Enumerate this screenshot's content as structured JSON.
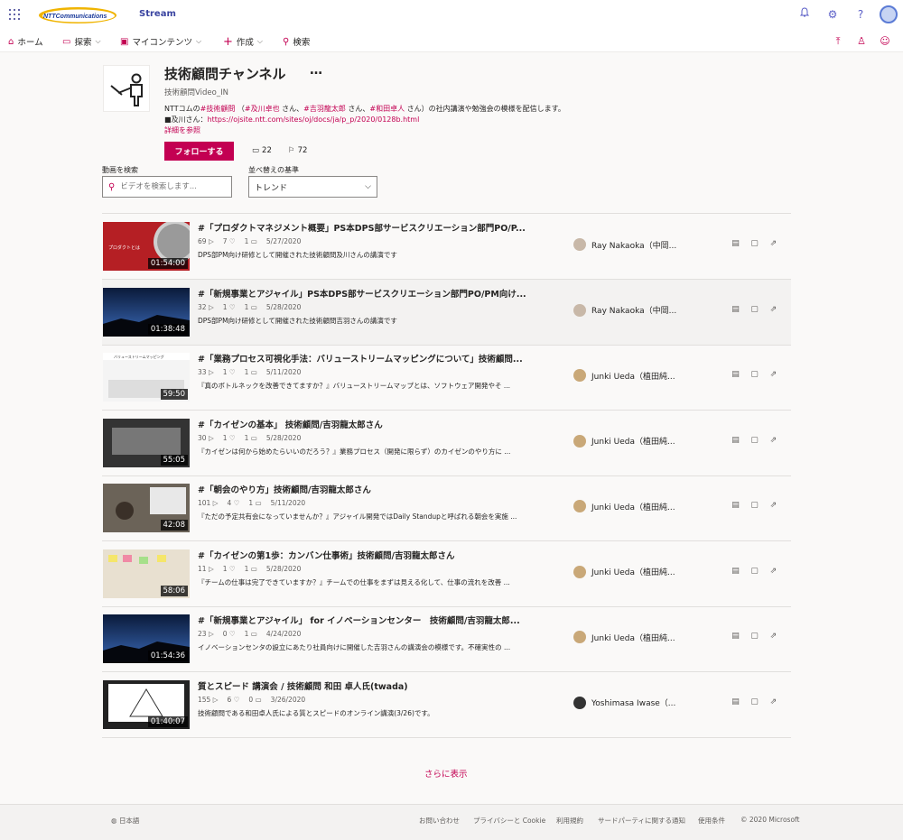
{
  "header": {
    "logo_text": "NTT Communications",
    "app_name": "Stream"
  },
  "nav": {
    "items": [
      {
        "label": "ホーム"
      },
      {
        "label": "探索"
      },
      {
        "label": "マイコンテンツ"
      },
      {
        "label": "作成"
      },
      {
        "label": "検索"
      }
    ]
  },
  "channel": {
    "title": "技術顧問チャンネル",
    "more": "…",
    "subtitle": "技術顧問Video_IN",
    "desc_prefix": "NTTコムの",
    "tag1": "#技術顧問",
    "desc_mid1": "（",
    "tag2": "#及川卓也",
    "desc_mid2": "さん、",
    "tag3": "#吉羽龍太郎",
    "desc_mid3": "さん、",
    "tag4": "#和田卓人",
    "desc_suffix": "さん）の社内講演や勉強会の模様を配信します。",
    "link_prefix": "■及川さん：",
    "link_url": "https://ojsite.ntt.com/sites/oj/docs/ja/p_p/2020/0128b.html",
    "details": "詳細を参照",
    "follow": "フォローする",
    "video_count": "22",
    "follower_count": "72"
  },
  "filters": {
    "search_label": "動画を検索",
    "search_placeholder": "ビデオを検索します...",
    "sort_label": "並べ替えの基準",
    "sort_value": "トレンド"
  },
  "videos": [
    {
      "title": "#「プロダクトマネジメント概要」PS本DPS部サービスクリエーション部門PO/P...",
      "views": "69",
      "likes": "7",
      "comments": "1",
      "date": "5/27/2020",
      "desc": "DPS部PM向け研修として開催された技術顧問及川さんの講演です",
      "author": "Ray Nakaoka（中岡...",
      "duration": "01:54:00"
    },
    {
      "title": "#「新規事業とアジャイル」PS本DPS部サービスクリエーション部門PO/PM向け...",
      "views": "32",
      "likes": "1",
      "comments": "1",
      "date": "5/28/2020",
      "desc": "DPS部PM向け研修として開催された技術顧問吉羽さんの講演です",
      "author": "Ray Nakaoka（中岡...",
      "duration": "01:38:48"
    },
    {
      "title": "#「業務プロセス可視化手法：バリューストリームマッピングについて」技術顧問...",
      "views": "33",
      "likes": "1",
      "comments": "1",
      "date": "5/11/2020",
      "desc": "『真のボトルネックを改善できてますか？』バリューストリームマップとは、ソフトウェア開発やそ ...",
      "author": "Junki Ueda（植田純...",
      "duration": "59:50"
    },
    {
      "title": "#「カイゼンの基本」 技術顧問/吉羽龍太郎さん",
      "views": "30",
      "likes": "1",
      "comments": "1",
      "date": "5/28/2020",
      "desc": "『カイゼンは何から始めたらいいのだろう？』業務プロセス（開発に限らず）のカイゼンのやり方に ...",
      "author": "Junki Ueda（植田純...",
      "duration": "55:05"
    },
    {
      "title": "#「朝会のやり方」技術顧問/吉羽龍太郎さん",
      "views": "101",
      "likes": "4",
      "comments": "1",
      "date": "5/11/2020",
      "desc": "『ただの予定共有会になっていませんか？』アジャイル開発ではDaily Standupと呼ばれる朝会を実施 ...",
      "author": "Junki Ueda（植田純...",
      "duration": "42:08"
    },
    {
      "title": "#「カイゼンの第1歩：カンバン仕事術」技術顧問/吉羽龍太郎さん",
      "views": "11",
      "likes": "1",
      "comments": "1",
      "date": "5/28/2020",
      "desc": "『チームの仕事は完了できていますか？』チームでの仕事をまずは見える化して、仕事の流れを改善 ...",
      "author": "Junki Ueda（植田純...",
      "duration": "58:06"
    },
    {
      "title": "#「新規事業とアジャイル」 for イノベーションセンター　技術顧問/吉羽龍太郎...",
      "views": "23",
      "likes": "0",
      "comments": "1",
      "date": "4/24/2020",
      "desc": "イノベーションセンタの設立にあたり社員向けに開催した吉羽さんの講演会の模様です。不確実性の ...",
      "author": "Junki Ueda（植田純...",
      "duration": "01:54:36"
    },
    {
      "title": "質とスピード 講演会 / 技術顧問 和田 卓人氏(twada)",
      "views": "155",
      "likes": "6",
      "comments": "0",
      "date": "3/26/2020",
      "desc": "技術顧問である和田卓人氏による質とスピードのオンライン講演(3/26)です。",
      "author": "Yoshimasa Iwase（...",
      "duration": "01:40:07"
    }
  ],
  "thumb_text": {
    "v1": "プロダクトとは",
    "v3": "バリューストリームマッピング"
  },
  "more": "さらに表示",
  "footer": {
    "language": "日本語",
    "contact": "お問い合わせ",
    "privacy": "プライバシーと Cookie",
    "terms": "利用規約",
    "third_party": "サードパーティに関する通知",
    "conditions": "使用条件",
    "copyright": "© 2020 Microsoft"
  },
  "colors": {
    "accent": "#c30052",
    "brand": "#3a44a0"
  }
}
